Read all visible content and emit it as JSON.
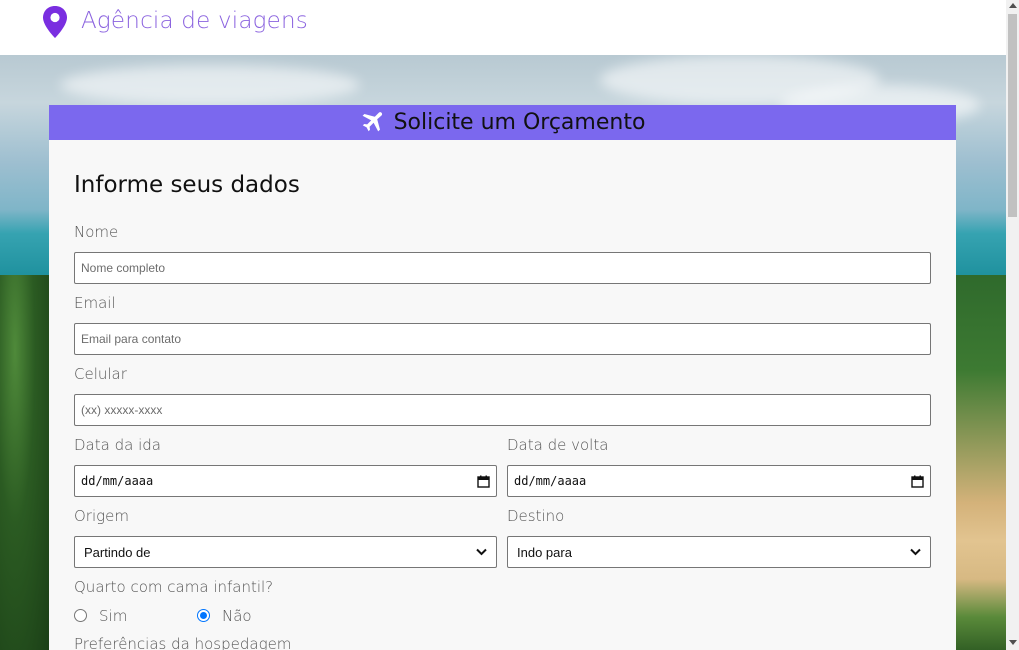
{
  "header": {
    "brand": "Agência de viagens",
    "logo_icon": "map-pin-icon",
    "brand_color": "#8b63df"
  },
  "card": {
    "title": "Solicite um Orçamento",
    "title_icon": "airplane-icon",
    "accent_color": "#7b68ee",
    "section_title": "Informe seus dados"
  },
  "form": {
    "name": {
      "label": "Nome",
      "placeholder": "Nome completo",
      "value": ""
    },
    "email": {
      "label": "Email",
      "placeholder": "Email para contato",
      "value": ""
    },
    "phone": {
      "label": "Celular",
      "placeholder": "(xx) xxxxx-xxxx",
      "value": ""
    },
    "departure_date": {
      "label": "Data da ida",
      "value": "dd/mm/aaaa"
    },
    "return_date": {
      "label": "Data de volta",
      "value": "dd/mm/aaaa"
    },
    "origin": {
      "label": "Origem",
      "selected": "Partindo de"
    },
    "destination": {
      "label": "Destino",
      "selected": "Indo para"
    },
    "child_bed": {
      "label": "Quarto com cama infantil?",
      "options": [
        {
          "label": "Sim",
          "checked": false
        },
        {
          "label": "Não",
          "checked": true
        }
      ]
    },
    "preferences_label": "Preferências da hospedagem"
  }
}
